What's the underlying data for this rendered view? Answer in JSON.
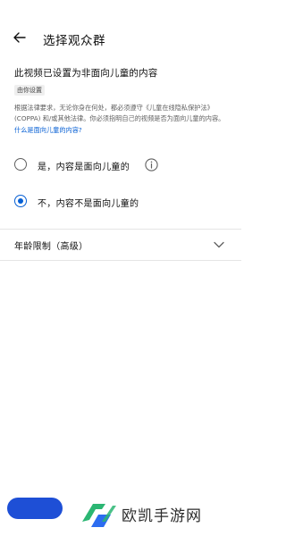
{
  "app_bar": {
    "title": "选择观众群",
    "back_icon": "arrow-left-icon"
  },
  "status": {
    "heading": "此视频已设置为非面向儿童的内容",
    "chip": "由你设置"
  },
  "explanation": {
    "text": "根据法律要求，无论你身在何处，都必须遵守《儿童在线隐私保护法》(COPPA) 和/或其他法律。你必须指明自己的视频是否为面向儿童的内容。",
    "link": "什么是面向儿童的内容?"
  },
  "options": [
    {
      "label": "是，内容是面向儿童的",
      "checked": false
    },
    {
      "label": "不，内容不是面向儿童的",
      "checked": true
    }
  ],
  "age_restriction": {
    "label": "年龄限制（高级）",
    "icon": "chevron-down-icon"
  },
  "watermark": {
    "text": "欧凯手游网"
  },
  "colors": {
    "accent": "#065fd4",
    "bottom_button": "#1e4fd6",
    "watermark_green": "#2bb673",
    "watermark_blue": "#2c6cf0"
  }
}
